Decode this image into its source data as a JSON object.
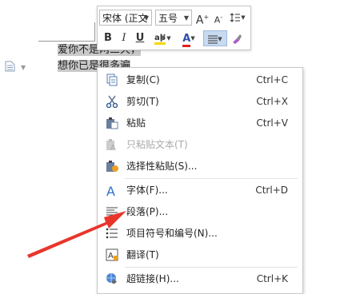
{
  "document": {
    "line1": "爱你不是两三天，",
    "line2": "想你已是很多遍"
  },
  "toolbar": {
    "font_name": "宋体 (正文",
    "font_size": "五号",
    "grow_font": "A",
    "shrink_font": "A",
    "bold": "B",
    "italic": "I",
    "underline": "U",
    "font_color": "A"
  },
  "menu": {
    "items": [
      {
        "label": "复制(C)",
        "shortcut": "Ctrl+C",
        "icon": "copy-icon"
      },
      {
        "label": "剪切(T)",
        "shortcut": "Ctrl+X",
        "icon": "cut-icon"
      },
      {
        "label": "粘贴",
        "shortcut": "Ctrl+V",
        "icon": "paste-icon"
      },
      {
        "label": "只粘贴文本(T)",
        "shortcut": "",
        "icon": "paste-text-icon",
        "disabled": true
      },
      {
        "label": "选择性粘贴(S)...",
        "shortcut": "",
        "icon": "paste-special-icon"
      },
      {
        "label": "字体(F)...",
        "shortcut": "Ctrl+D",
        "icon": "font-icon"
      },
      {
        "label": "段落(P)...",
        "shortcut": "",
        "icon": "paragraph-icon"
      },
      {
        "label": "项目符号和编号(N)...",
        "shortcut": "",
        "icon": "bullets-icon"
      },
      {
        "label": "翻译(T)",
        "shortcut": "",
        "icon": "translate-icon"
      },
      {
        "label": "超链接(H)...",
        "shortcut": "Ctrl+K",
        "icon": "hyperlink-icon"
      }
    ]
  },
  "colors": {
    "selection": "#c9c9c9",
    "arrow": "#e8352c",
    "accent_blue": "#2f6fd1",
    "highlight_yellow": "#f5d800",
    "font_color_red": "#e02020"
  }
}
